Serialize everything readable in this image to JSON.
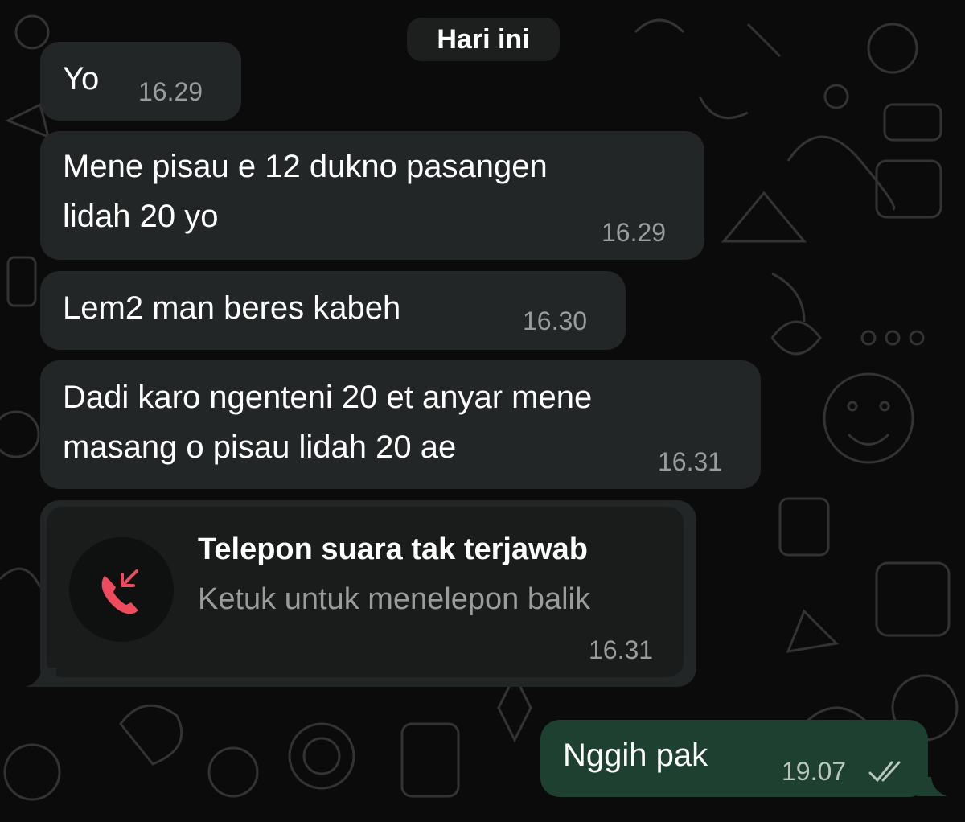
{
  "chat": {
    "date_divider": "Hari ini",
    "messages": [
      {
        "text": "Yo",
        "time": "16.29"
      },
      {
        "text_line1": "Mene pisau e 12 dukno pasangen",
        "text_line2": "lidah 20 yo",
        "time": "16.29"
      },
      {
        "text": "Lem2 man beres kabeh",
        "time": "16.30"
      },
      {
        "text_line1": "Dadi karo ngenteni 20 et anyar mene",
        "text_line2": "masang o pisau lidah 20 ae",
        "time": "16.31"
      }
    ],
    "missed_call": {
      "title": "Telepon suara tak terjawab",
      "subtitle": "Ketuk untuk menelepon balik",
      "time": "16.31",
      "icon": "missed-call-icon"
    },
    "outgoing": {
      "text": "Nggih pak",
      "time": "19.07",
      "status_icon": "double-check-icon"
    }
  },
  "colors": {
    "background": "#0b0b0b",
    "incoming_bubble": "#232626",
    "outgoing_bubble": "#1d4030",
    "missed_call_red": "#ef4b5f"
  }
}
